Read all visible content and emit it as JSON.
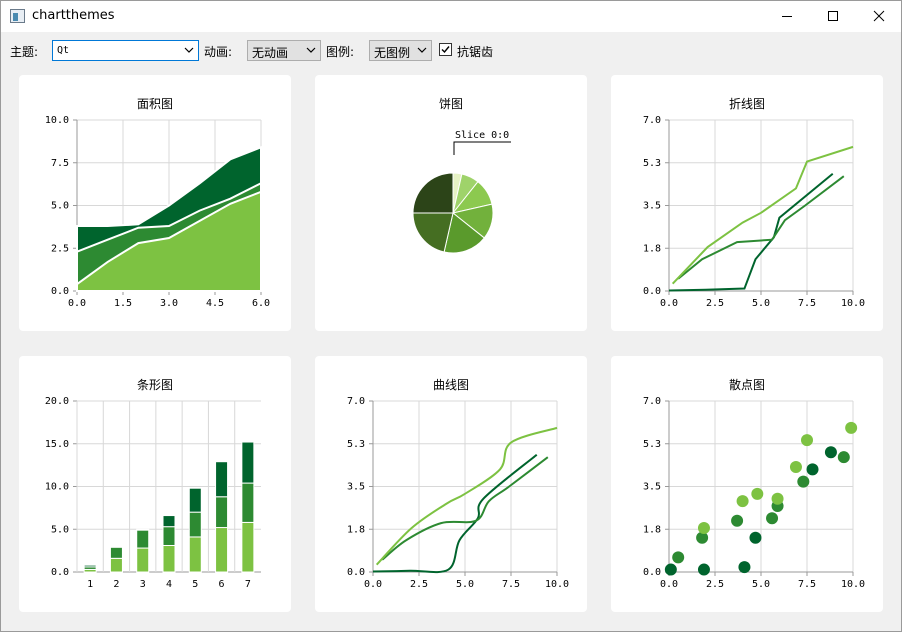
{
  "window": {
    "title": "chartthemes",
    "icon": "app-window-icon",
    "controls": [
      "minimize-icon",
      "maximize-icon",
      "close-icon"
    ]
  },
  "toolbar": {
    "theme_label": "主题:",
    "theme_value": "Qt",
    "animation_label": "动画:",
    "animation_value": "无动画",
    "legend_label": "图例:",
    "legend_value": "无图例",
    "antialias_label": "抗锯齿",
    "antialias_checked": true
  },
  "colors": {
    "dark": "#00642d",
    "medium": "#2d8a32",
    "light": "#7dc242",
    "lighter": "#9fd36a",
    "pie": [
      "#e6f2c4",
      "#9fd36a",
      "#8cc94f",
      "#72b13c",
      "#5a9a2c",
      "#456e22",
      "#2c4418"
    ]
  },
  "chart_data": [
    {
      "type": "area",
      "title": "面积图",
      "xlim": [
        0,
        6
      ],
      "ylim": [
        0,
        10
      ],
      "xticks": [
        "0.0",
        "1.5",
        "3.0",
        "4.5",
        "6.0"
      ],
      "yticks": [
        "0.0",
        "2.5",
        "5.0",
        "7.5",
        "10.0"
      ],
      "x": [
        0,
        1,
        2,
        3,
        4,
        5,
        6
      ],
      "series": [
        {
          "values": [
            3.8,
            3.8,
            3.9,
            5.0,
            6.3,
            7.7,
            8.4
          ]
        },
        {
          "values": [
            2.3,
            3.0,
            3.7,
            3.8,
            4.7,
            5.4,
            6.3
          ]
        },
        {
          "values": [
            0.4,
            1.7,
            2.8,
            3.1,
            4.1,
            5.1,
            5.8
          ]
        }
      ]
    },
    {
      "type": "pie",
      "title": "饼图",
      "annotation": "Slice 0:0",
      "values": [
        0.5,
        1,
        1.5,
        2,
        2.5,
        3,
        3.5
      ]
    },
    {
      "type": "line",
      "title": "折线图",
      "xlim": [
        0,
        10
      ],
      "ylim": [
        0,
        7
      ],
      "xticks": [
        "0.0",
        "2.5",
        "5.0",
        "7.5",
        "10.0"
      ],
      "yticks": [
        "0.0",
        "1.8",
        "3.5",
        "5.3",
        "7.0"
      ],
      "series": [
        {
          "x": [
            0,
            2,
            4.1,
            4.7,
            5.7,
            6,
            8.9
          ],
          "y": [
            0.02,
            0.05,
            0.1,
            1.3,
            2.2,
            3.0,
            4.8
          ]
        },
        {
          "x": [
            0.5,
            1.8,
            3.7,
            5.6,
            6.3,
            7.4,
            9.5
          ],
          "y": [
            0.5,
            1.3,
            2.0,
            2.1,
            2.9,
            3.5,
            4.7
          ]
        },
        {
          "x": [
            0.2,
            2.1,
            4,
            5,
            6.9,
            7.5,
            10
          ],
          "y": [
            0.3,
            1.8,
            2.8,
            3.2,
            4.2,
            5.3,
            5.9
          ]
        }
      ]
    },
    {
      "type": "bar",
      "title": "条形图",
      "ylim": [
        0,
        20
      ],
      "categories": [
        "1",
        "2",
        "3",
        "4",
        "5",
        "6",
        "7"
      ],
      "yticks": [
        "0.0",
        "5.0",
        "10.0",
        "15.0",
        "20.0"
      ],
      "series": [
        {
          "values": [
            0.3,
            1.6,
            2.8,
            3.1,
            4.1,
            5.2,
            5.8
          ]
        },
        {
          "values": [
            0.3,
            1.3,
            2.1,
            2.2,
            2.9,
            3.6,
            4.6
          ]
        },
        {
          "values": [
            0.2,
            0.1,
            0.1,
            1.3,
            2.8,
            4.1,
            4.8
          ]
        }
      ]
    },
    {
      "type": "line",
      "title": "曲线图",
      "xlim": [
        0,
        10
      ],
      "ylim": [
        0,
        7
      ],
      "xticks": [
        "0.0",
        "2.5",
        "5.0",
        "7.5",
        "10.0"
      ],
      "yticks": [
        "0.0",
        "1.8",
        "3.5",
        "5.3",
        "7.0"
      ],
      "series": [
        {
          "x": [
            0,
            2,
            4.1,
            4.7,
            5.7,
            6,
            8.9
          ],
          "y": [
            0.02,
            0.05,
            0.1,
            1.3,
            2.2,
            3.0,
            4.8
          ]
        },
        {
          "x": [
            0.5,
            1.8,
            3.7,
            5.6,
            6.3,
            7.4,
            9.5
          ],
          "y": [
            0.5,
            1.3,
            2.0,
            2.1,
            2.9,
            3.5,
            4.7
          ]
        },
        {
          "x": [
            0.2,
            2.1,
            4,
            5,
            6.9,
            7.5,
            10
          ],
          "y": [
            0.3,
            1.8,
            2.8,
            3.2,
            4.2,
            5.3,
            5.9
          ]
        }
      ]
    },
    {
      "type": "scatter",
      "title": "散点图",
      "xlim": [
        0,
        10
      ],
      "ylim": [
        0,
        7
      ],
      "xticks": [
        "0.0",
        "2.5",
        "5.0",
        "7.5",
        "10.0"
      ],
      "yticks": [
        "0.0",
        "1.8",
        "3.5",
        "5.3",
        "7.0"
      ],
      "series": [
        {
          "x": [
            0.1,
            1.9,
            4.1,
            4.7,
            7.8,
            8.8
          ],
          "y": [
            0.1,
            0.1,
            0.2,
            1.4,
            4.2,
            4.9
          ]
        },
        {
          "x": [
            0.5,
            1.8,
            3.7,
            5.6,
            5.9,
            7.3,
            9.5
          ],
          "y": [
            0.6,
            1.4,
            2.1,
            2.2,
            2.7,
            3.7,
            4.7
          ]
        },
        {
          "x": [
            1.9,
            4.0,
            4.8,
            5.9,
            6.9,
            7.5,
            9.9
          ],
          "y": [
            1.8,
            2.9,
            3.2,
            3.0,
            4.3,
            5.4,
            5.9
          ]
        }
      ]
    }
  ]
}
